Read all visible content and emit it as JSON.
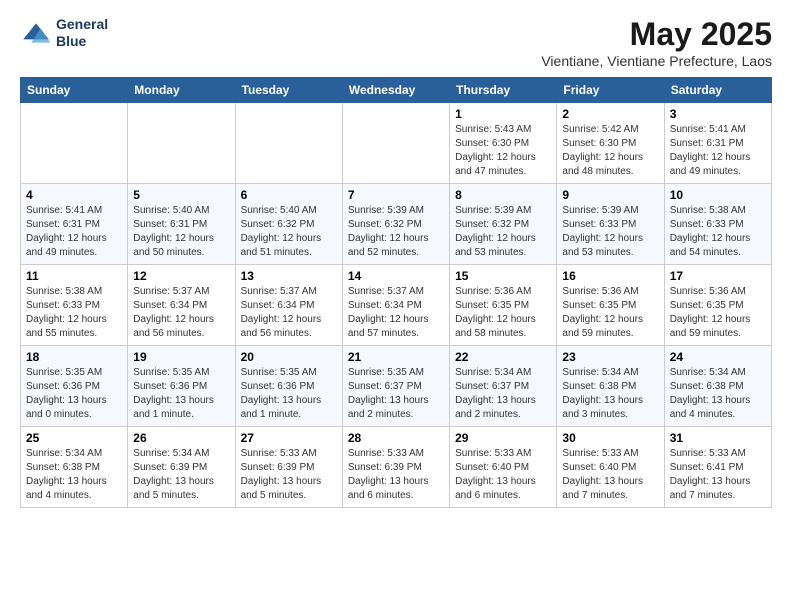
{
  "header": {
    "logo_line1": "General",
    "logo_line2": "Blue",
    "month": "May 2025",
    "location": "Vientiane, Vientiane Prefecture, Laos"
  },
  "weekdays": [
    "Sunday",
    "Monday",
    "Tuesday",
    "Wednesday",
    "Thursday",
    "Friday",
    "Saturday"
  ],
  "weeks": [
    [
      {
        "day": "",
        "info": ""
      },
      {
        "day": "",
        "info": ""
      },
      {
        "day": "",
        "info": ""
      },
      {
        "day": "",
        "info": ""
      },
      {
        "day": "1",
        "info": "Sunrise: 5:43 AM\nSunset: 6:30 PM\nDaylight: 12 hours\nand 47 minutes."
      },
      {
        "day": "2",
        "info": "Sunrise: 5:42 AM\nSunset: 6:30 PM\nDaylight: 12 hours\nand 48 minutes."
      },
      {
        "day": "3",
        "info": "Sunrise: 5:41 AM\nSunset: 6:31 PM\nDaylight: 12 hours\nand 49 minutes."
      }
    ],
    [
      {
        "day": "4",
        "info": "Sunrise: 5:41 AM\nSunset: 6:31 PM\nDaylight: 12 hours\nand 49 minutes."
      },
      {
        "day": "5",
        "info": "Sunrise: 5:40 AM\nSunset: 6:31 PM\nDaylight: 12 hours\nand 50 minutes."
      },
      {
        "day": "6",
        "info": "Sunrise: 5:40 AM\nSunset: 6:32 PM\nDaylight: 12 hours\nand 51 minutes."
      },
      {
        "day": "7",
        "info": "Sunrise: 5:39 AM\nSunset: 6:32 PM\nDaylight: 12 hours\nand 52 minutes."
      },
      {
        "day": "8",
        "info": "Sunrise: 5:39 AM\nSunset: 6:32 PM\nDaylight: 12 hours\nand 53 minutes."
      },
      {
        "day": "9",
        "info": "Sunrise: 5:39 AM\nSunset: 6:33 PM\nDaylight: 12 hours\nand 53 minutes."
      },
      {
        "day": "10",
        "info": "Sunrise: 5:38 AM\nSunset: 6:33 PM\nDaylight: 12 hours\nand 54 minutes."
      }
    ],
    [
      {
        "day": "11",
        "info": "Sunrise: 5:38 AM\nSunset: 6:33 PM\nDaylight: 12 hours\nand 55 minutes."
      },
      {
        "day": "12",
        "info": "Sunrise: 5:37 AM\nSunset: 6:34 PM\nDaylight: 12 hours\nand 56 minutes."
      },
      {
        "day": "13",
        "info": "Sunrise: 5:37 AM\nSunset: 6:34 PM\nDaylight: 12 hours\nand 56 minutes."
      },
      {
        "day": "14",
        "info": "Sunrise: 5:37 AM\nSunset: 6:34 PM\nDaylight: 12 hours\nand 57 minutes."
      },
      {
        "day": "15",
        "info": "Sunrise: 5:36 AM\nSunset: 6:35 PM\nDaylight: 12 hours\nand 58 minutes."
      },
      {
        "day": "16",
        "info": "Sunrise: 5:36 AM\nSunset: 6:35 PM\nDaylight: 12 hours\nand 59 minutes."
      },
      {
        "day": "17",
        "info": "Sunrise: 5:36 AM\nSunset: 6:35 PM\nDaylight: 12 hours\nand 59 minutes."
      }
    ],
    [
      {
        "day": "18",
        "info": "Sunrise: 5:35 AM\nSunset: 6:36 PM\nDaylight: 13 hours\nand 0 minutes."
      },
      {
        "day": "19",
        "info": "Sunrise: 5:35 AM\nSunset: 6:36 PM\nDaylight: 13 hours\nand 1 minute."
      },
      {
        "day": "20",
        "info": "Sunrise: 5:35 AM\nSunset: 6:36 PM\nDaylight: 13 hours\nand 1 minute."
      },
      {
        "day": "21",
        "info": "Sunrise: 5:35 AM\nSunset: 6:37 PM\nDaylight: 13 hours\nand 2 minutes."
      },
      {
        "day": "22",
        "info": "Sunrise: 5:34 AM\nSunset: 6:37 PM\nDaylight: 13 hours\nand 2 minutes."
      },
      {
        "day": "23",
        "info": "Sunrise: 5:34 AM\nSunset: 6:38 PM\nDaylight: 13 hours\nand 3 minutes."
      },
      {
        "day": "24",
        "info": "Sunrise: 5:34 AM\nSunset: 6:38 PM\nDaylight: 13 hours\nand 4 minutes."
      }
    ],
    [
      {
        "day": "25",
        "info": "Sunrise: 5:34 AM\nSunset: 6:38 PM\nDaylight: 13 hours\nand 4 minutes."
      },
      {
        "day": "26",
        "info": "Sunrise: 5:34 AM\nSunset: 6:39 PM\nDaylight: 13 hours\nand 5 minutes."
      },
      {
        "day": "27",
        "info": "Sunrise: 5:33 AM\nSunset: 6:39 PM\nDaylight: 13 hours\nand 5 minutes."
      },
      {
        "day": "28",
        "info": "Sunrise: 5:33 AM\nSunset: 6:39 PM\nDaylight: 13 hours\nand 6 minutes."
      },
      {
        "day": "29",
        "info": "Sunrise: 5:33 AM\nSunset: 6:40 PM\nDaylight: 13 hours\nand 6 minutes."
      },
      {
        "day": "30",
        "info": "Sunrise: 5:33 AM\nSunset: 6:40 PM\nDaylight: 13 hours\nand 7 minutes."
      },
      {
        "day": "31",
        "info": "Sunrise: 5:33 AM\nSunset: 6:41 PM\nDaylight: 13 hours\nand 7 minutes."
      }
    ]
  ]
}
